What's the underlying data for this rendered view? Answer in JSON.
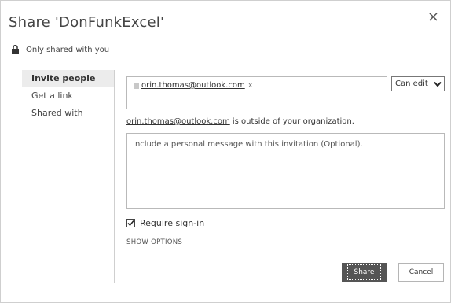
{
  "dialog": {
    "title": "Share 'DonFunkExcel'",
    "close_label": "×",
    "shared_status": "Only shared with you"
  },
  "sidebar": {
    "items": [
      {
        "label": "Invite people",
        "active": true
      },
      {
        "label": "Get a link",
        "active": false
      },
      {
        "label": "Shared with",
        "active": false
      }
    ]
  },
  "invite": {
    "recipient_email": "orin.thomas@outlook.com",
    "remove_label": "x",
    "permission": "Can edit",
    "warning_suffix": " is outside of your organization.",
    "message_placeholder": "Include a personal message with this invitation (Optional).",
    "require_signin_label": "Require sign-in",
    "require_signin_checked": true,
    "show_options_label": "SHOW OPTIONS"
  },
  "buttons": {
    "share_label": "Share",
    "cancel_label": "Cancel"
  },
  "colors": {
    "primary_button": "#555555",
    "active_nav_bg": "#ececec"
  }
}
